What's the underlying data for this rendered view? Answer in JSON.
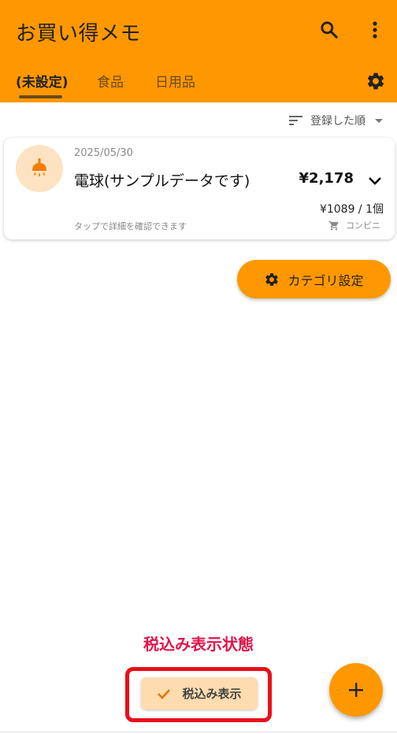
{
  "app": {
    "title": "お買い得メモ"
  },
  "tabs": [
    {
      "label": "(未設定)",
      "active": true
    },
    {
      "label": "食品",
      "active": false
    },
    {
      "label": "日用品",
      "active": false
    }
  ],
  "sort": {
    "label": "登録した順"
  },
  "items": [
    {
      "date": "2025/05/30",
      "name": "電球(サンプルデータです)",
      "price": "¥2,178",
      "unit_price": "¥1089 / 1個",
      "hint": "タップで詳細を確認できます",
      "store": "コンビニ",
      "icon": "lamp-icon"
    }
  ],
  "category_button": {
    "label": "カテゴリ設定"
  },
  "annotation": {
    "text": "税込み表示状態"
  },
  "tax_chip": {
    "label": "税込み表示",
    "selected": true
  },
  "colors": {
    "primary": "#ff9800",
    "annotation": "#e0164b",
    "chip_bg": "#ffdcb0",
    "avatar_bg": "#fde3c2"
  }
}
